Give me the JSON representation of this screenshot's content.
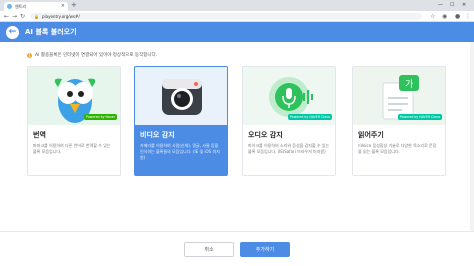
{
  "browser": {
    "tab_title": "엔트리",
    "url": "playentry.org/ws#/",
    "new_tab": "+",
    "win_min": "—",
    "win_max": "☐",
    "win_close": "✕"
  },
  "header": {
    "back_glyph": "←",
    "title": "AI 블록 불러오기"
  },
  "notice": {
    "icon": "!",
    "text": "AI 활용블록은 인터넷이 연결되어 있어야 정상적으로 동작합니다."
  },
  "cards": [
    {
      "title": "번역",
      "desc": "파파고를 이용하여 다른 언어로 번역할 수 있는 블록 모음입니다.",
      "badge": "Powered by Naver",
      "selected": false,
      "icon": "papago-parrot-icon"
    },
    {
      "title": "비디오 감지",
      "desc": "카메라를 이용하여 사람(신체), 얼굴, 사물 등을 인식하는 블록들의 모음입니다. (IE 및 iOS 미지원)",
      "badge": "",
      "selected": true,
      "icon": "camera-icon"
    },
    {
      "title": "오디오 감지",
      "desc": "마이크를 이용하여 소리와 음성을 감지할 수 있는 블록 모음입니다. (IE/Safari 브라우저 미지원)",
      "badge": "Powered by NAVER Clova",
      "selected": false,
      "icon": "microphone-icon"
    },
    {
      "title": "읽어주기",
      "desc": "nVoice 음성합성 기술로 다양한 목소리로 문장을 읽는 블록 모음입니다.",
      "badge": "Powered by NAVER Clova",
      "selected": false,
      "icon": "document-voice-icon"
    }
  ],
  "footer": {
    "cancel_label": "취소",
    "add_label": "추가하기"
  },
  "colors": {
    "primary": "#4c8ce5",
    "naver_green": "#2db400",
    "clova_green": "#00c7a5"
  }
}
